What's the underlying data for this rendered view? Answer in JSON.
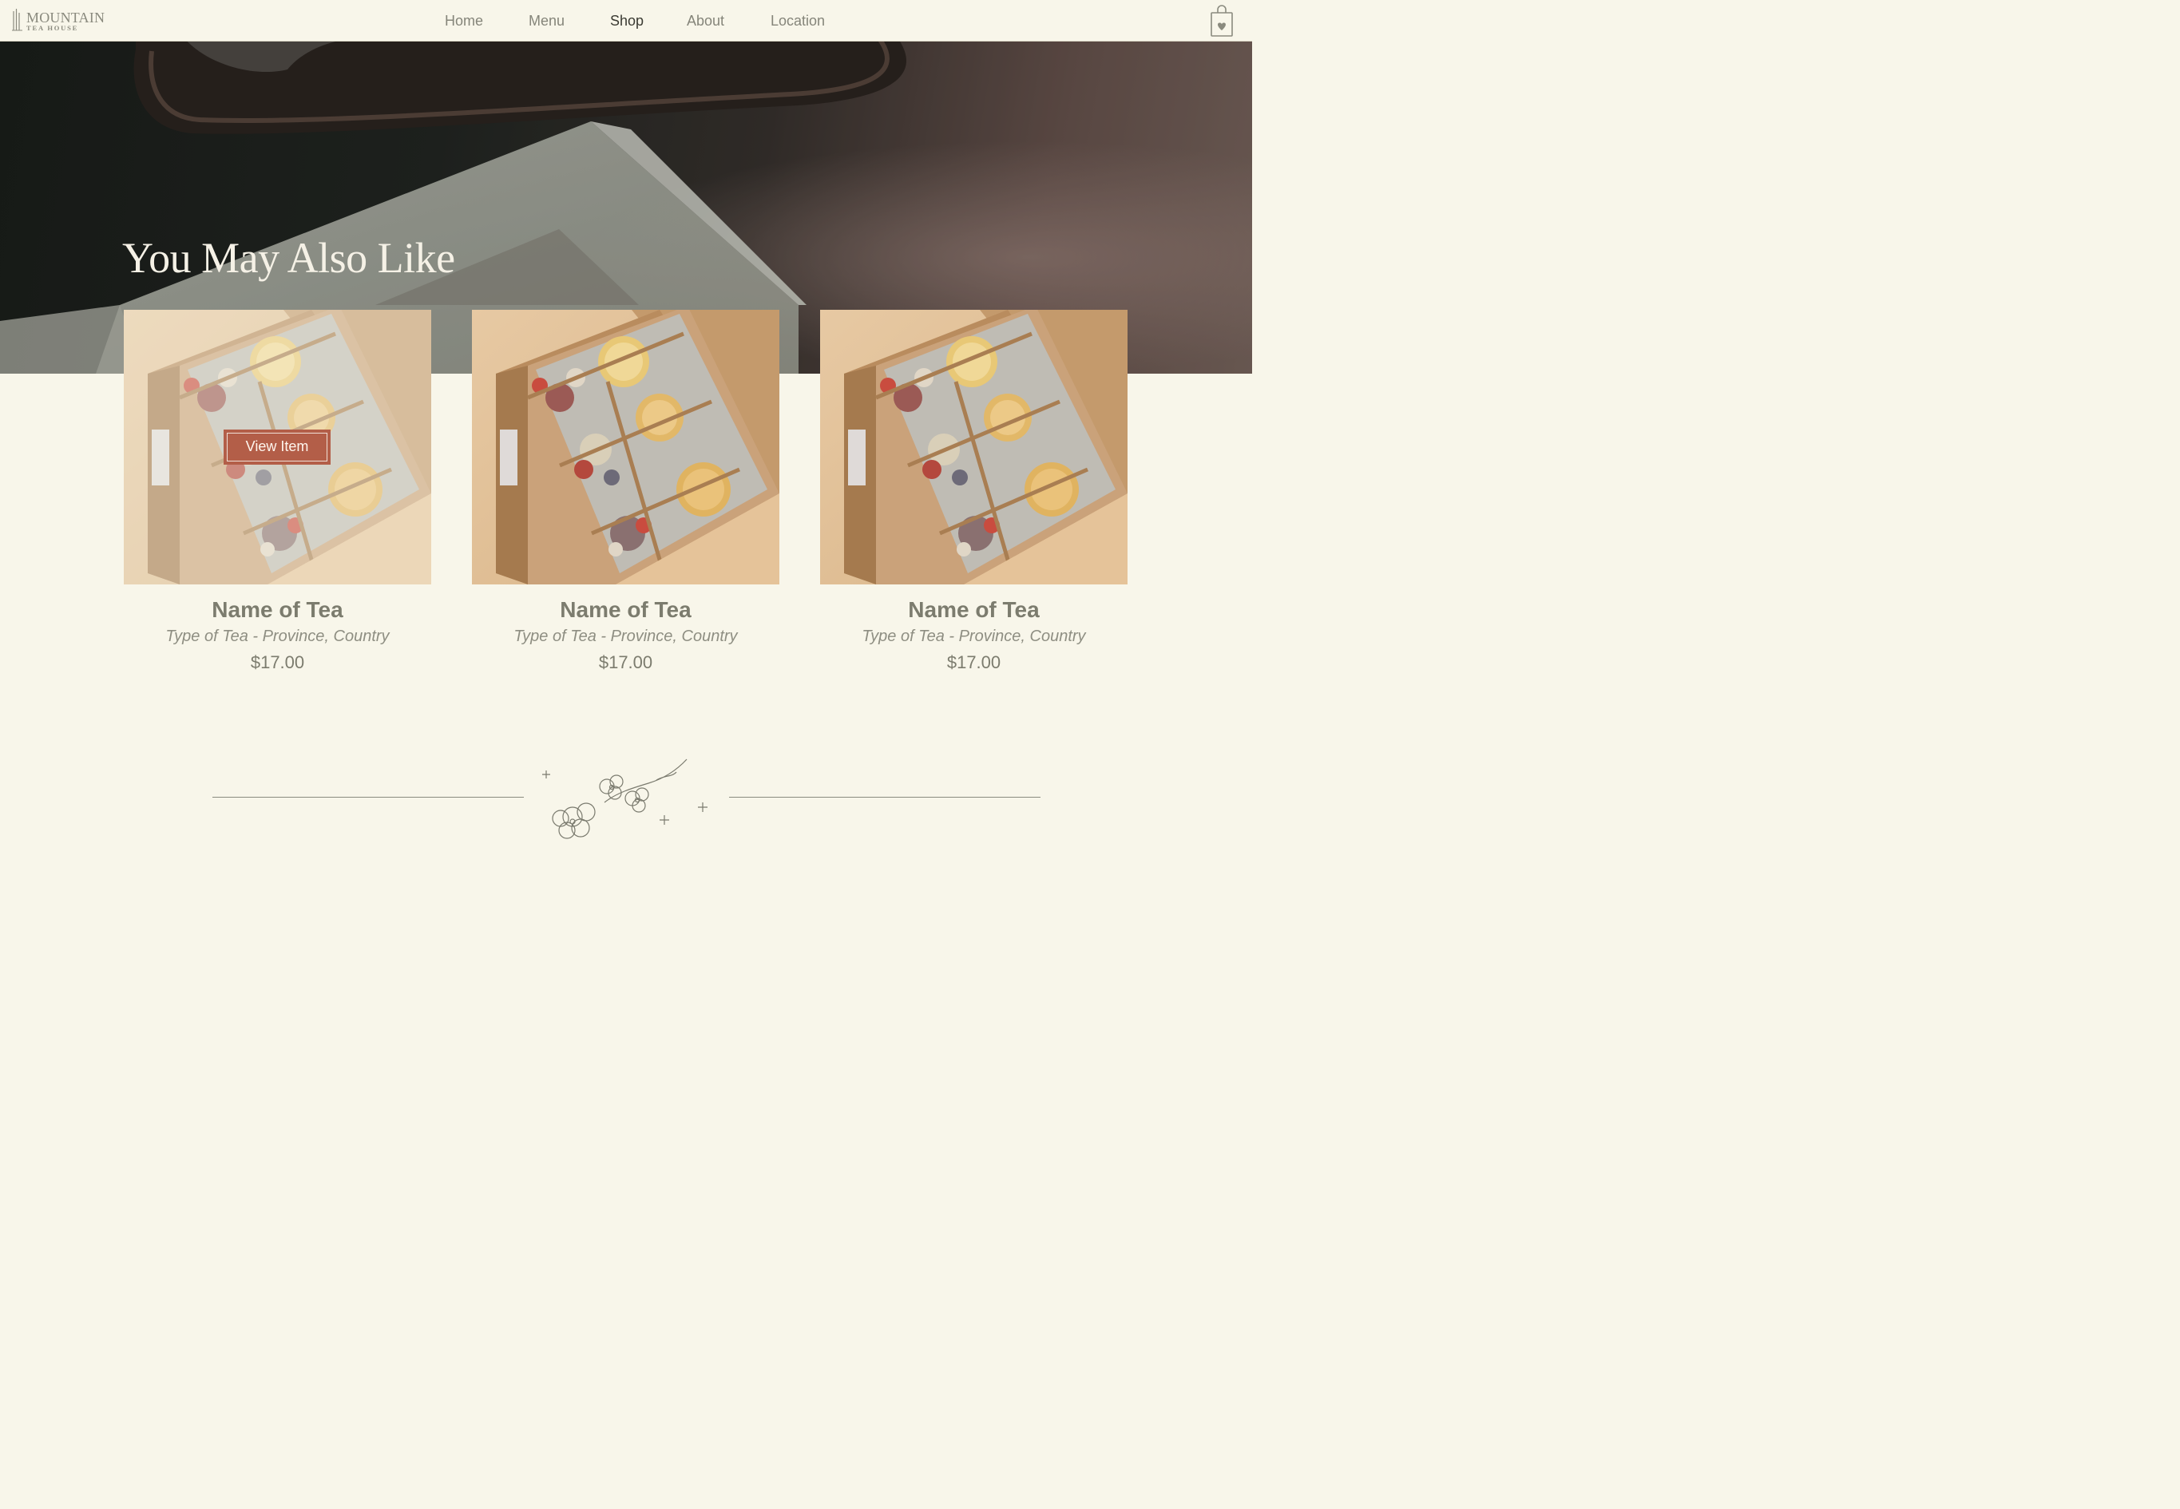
{
  "brand": {
    "name": "MOUNTAIN",
    "tagline": "TEA HOUSE"
  },
  "nav": {
    "items": [
      "Home",
      "Menu",
      "Shop",
      "About",
      "Location"
    ],
    "active": "Shop"
  },
  "icons": {
    "logo": "mountain-logo-icon",
    "cart": "shopping-bag-heart-icon",
    "divider": "blossom-branch-icon"
  },
  "hero": {
    "heading": "You May Also Like"
  },
  "products": [
    {
      "name": "Name of Tea",
      "type": "Type of Tea - Province, Country",
      "price": "$17.00",
      "button": "View Item"
    },
    {
      "name": "Name of Tea",
      "type": "Type of Tea - Province, Country",
      "price": "$17.00"
    },
    {
      "name": "Name of Tea",
      "type": "Type of Tea - Province, Country",
      "price": "$17.00"
    }
  ],
  "colors": {
    "background": "#f8f6ea",
    "accent": "#b35e48",
    "text": "#7c7c6e"
  }
}
